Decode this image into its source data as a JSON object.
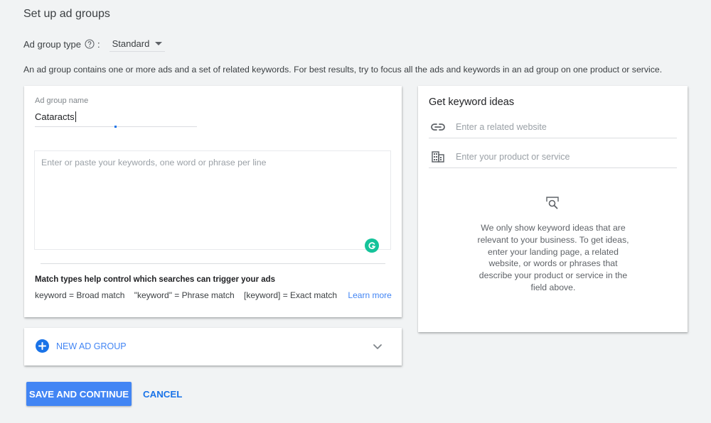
{
  "page": {
    "title": "Set up ad groups",
    "ad_group_type_label": "Ad group type",
    "ad_group_type_colon": ":",
    "ad_group_type_value": "Standard",
    "description": "An ad group contains one or more ads and a set of related keywords. For best results, try to focus all the ads and keywords in an ad group on one product or service."
  },
  "ad_group": {
    "name_label": "Ad group name",
    "name_value": "Cataracts",
    "keywords_placeholder": "Enter or paste your keywords, one word or phrase per line",
    "keywords_value": "",
    "match_title": "Match types help control which searches can trigger your ads",
    "match_types": [
      "keyword = Broad match",
      "\"keyword\" = Phrase match",
      "[keyword] = Exact match"
    ],
    "learn_more": "Learn more"
  },
  "keyword_ideas": {
    "title": "Get keyword ideas",
    "website_placeholder": "Enter a related website",
    "product_placeholder": "Enter your product or service",
    "message": "We only show keyword ideas that are relevant to your business. To get ideas, enter your landing page, a related website, or words or phrases that describe your product or service in the field above."
  },
  "new_ad_group": {
    "label": "NEW AD GROUP"
  },
  "actions": {
    "save": "SAVE AND CONTINUE",
    "cancel": "CANCEL"
  },
  "colors": {
    "accent": "#1a73e8",
    "button": "#4285f4",
    "grammarly": "#15c39a",
    "background": "#f1f3f4"
  }
}
